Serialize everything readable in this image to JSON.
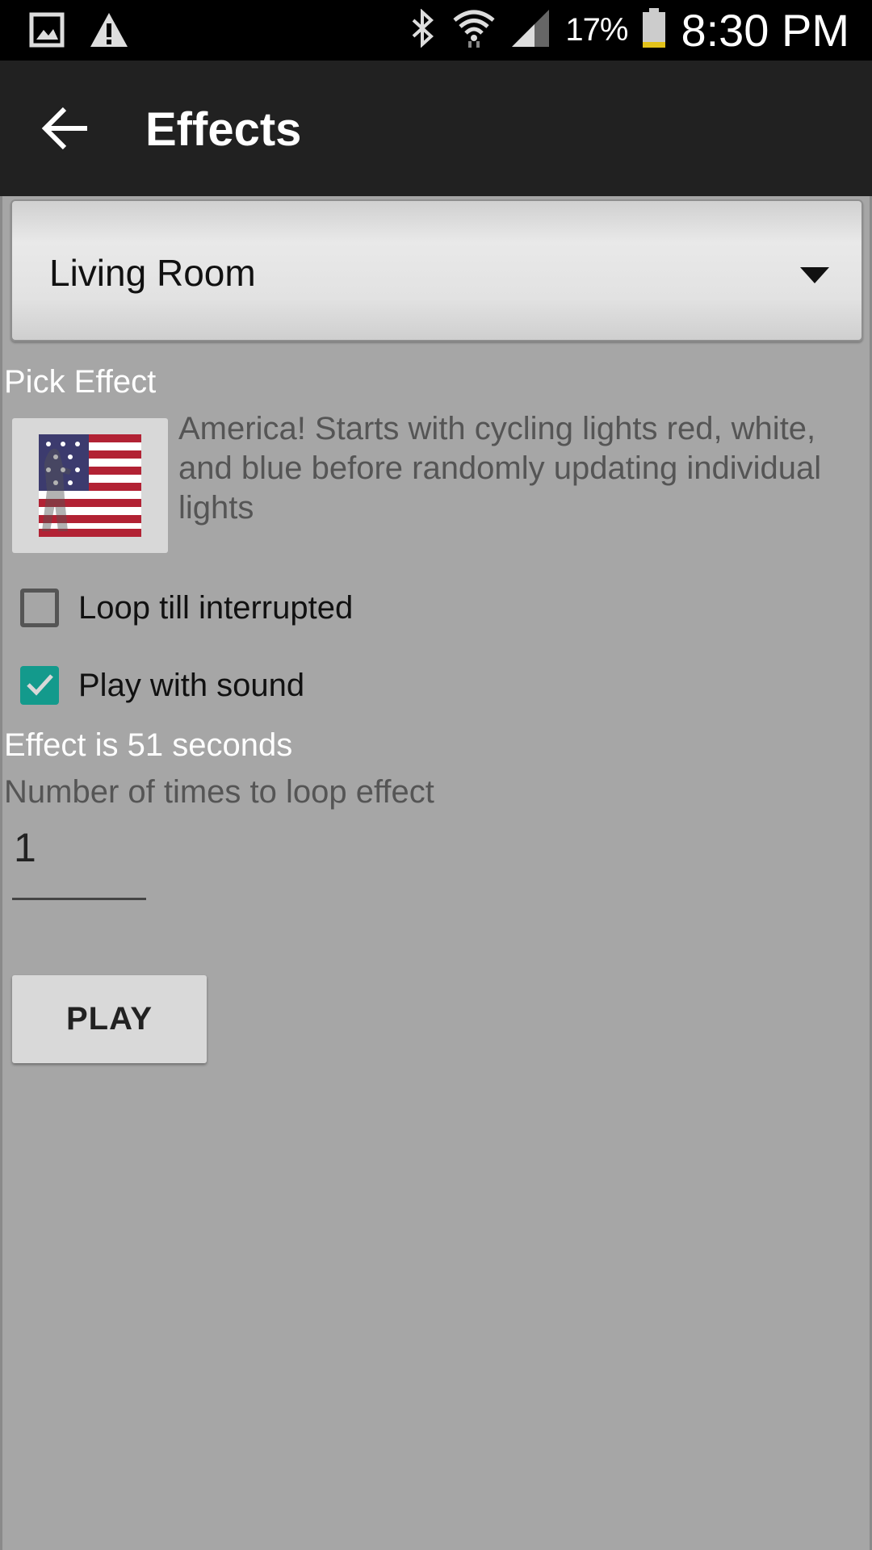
{
  "status_bar": {
    "left_icons": [
      "gallery-icon",
      "warning-icon"
    ],
    "right_icons": [
      "bluetooth-icon",
      "wifi-icon",
      "signal-icon",
      "battery-icon"
    ],
    "battery_percent": "17%",
    "time": "8:30 PM"
  },
  "app_bar": {
    "title": "Effects",
    "back_icon": "arrow-back-icon"
  },
  "room_spinner": {
    "selected": "Living Room"
  },
  "pick_effect": {
    "label": "Pick Effect",
    "thumbnail_icon": "american-flag-icon",
    "description": "America! Starts with cycling lights red, white, and blue before randomly updating individual lights"
  },
  "options": {
    "loop": {
      "label": "Loop till interrupted",
      "checked": false
    },
    "sound": {
      "label": "Play with sound",
      "checked": true
    }
  },
  "duration_text": "Effect is 51 seconds",
  "loop_count": {
    "label": "Number of times to loop effect",
    "value": "1"
  },
  "play_button": {
    "label": "PLAY"
  },
  "colors": {
    "app_bar": "#212121",
    "content_bg": "#a6a6a6",
    "checkbox_checked": "#139a8c",
    "battery_level": "#e2c21a"
  }
}
